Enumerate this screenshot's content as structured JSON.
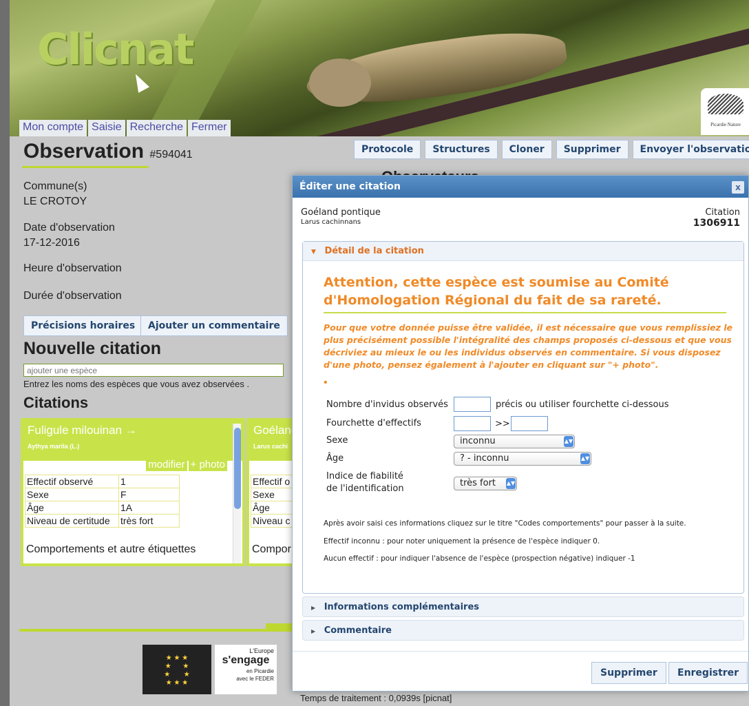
{
  "logo": "Clicnat",
  "partner_logo": "Picardie Nature",
  "nav": [
    "Mon compte",
    "Saisie",
    "Recherche",
    "Fermer"
  ],
  "toolbar": [
    "Protocole",
    "Structures",
    "Cloner",
    "Supprimer",
    "Envoyer l'observation"
  ],
  "observation": {
    "title": "Observation",
    "id": "#594041",
    "commune_label": "Commune(s)",
    "commune": "LE CROTOY",
    "date_label": "Date d'observation",
    "date": "17-12-2016",
    "heure_label": "Heure d'observation",
    "duree_label": "Durée d'observation",
    "btn_precisions": "Précisions horaires",
    "btn_commentaire": "Ajouter un commentaire",
    "observateurs": "Observateurs"
  },
  "new_citation": {
    "title": "Nouvelle citation",
    "placeholder": "ajouter une espèce",
    "help": "Entrez les noms des espèces que vous avez observées ."
  },
  "citations": {
    "title": "Citations",
    "cards": [
      {
        "name": "Fuligule milouinan →",
        "sci": "Aythya marila (L.)",
        "modify": "modifier",
        "photo": "+ photo",
        "rows": [
          [
            "Effectif observé",
            "1"
          ],
          [
            "Sexe",
            "F"
          ],
          [
            "Âge",
            "1A"
          ],
          [
            "Niveau de certitude",
            "très fort"
          ]
        ],
        "behaviours": "Comportements et autre étiquettes"
      },
      {
        "name": "Goéland",
        "sci": "Larus cachi",
        "rows": [
          [
            "Effectif o",
            ""
          ],
          [
            "Sexe",
            ""
          ],
          [
            "Âge",
            ""
          ],
          [
            "Niveau c",
            ""
          ]
        ],
        "behaviours": "Compor"
      }
    ]
  },
  "footer": {
    "europe_top": "L'Europe",
    "europe_mid": "s'engage",
    "europe_bot": "en Picardie",
    "europe_fund": "avec le FEDER",
    "timing": "Temps de traitement : 0,0939s [picnat]"
  },
  "dialog": {
    "title": "Éditer une citation",
    "close": "x",
    "species_common": "Goéland pontique",
    "species_sci": "Larus cachinnans",
    "citation_label": "Citation",
    "citation_id": "1306911",
    "section_detail": "Détail de la citation",
    "warning_title": "Attention, cette espèce est soumise au Comité d'Homologation Régional du fait de sa rareté.",
    "warning_body": "Pour que votre donnée puisse être validée, il est nécessaire que vous remplissiez le plus précisément possible l'intégralité des champs proposés ci-dessous et que vous décriviez au mieux le ou les individus observés en commentaire. Si vous disposez d'une photo, pensez également à l'ajouter en cliquant sur \"+ photo\".",
    "dot": "•",
    "field_nombre": "Nombre d'invidus observés",
    "field_nombre_hint": "précis ou utiliser fourchette ci-dessous",
    "field_fourchette": "Fourchette d'effectifs",
    "fourchette_sep": ">>",
    "field_sexe": "Sexe",
    "sexe_value": "inconnu",
    "field_age": "Âge",
    "age_value": "? - inconnu",
    "field_fiabilite_1": "Indice de fiabilité",
    "field_fiabilite_2": "de l'identification",
    "fiabilite_value": "très fort",
    "note1": "Après avoir saisi ces informations cliquez sur le titre \"Codes comportements\" pour passer à la suite.",
    "note2": "Effectif inconnu : pour noter uniquement la présence de l'espèce indiquer 0.",
    "note3": "Aucun effectif : pour indiquer l'absence de l'espèce (prospection négative) indiquer -1",
    "section_infos": "Informations complémentaires",
    "section_commentaire": "Commentaire",
    "btn_supprimer": "Supprimer",
    "btn_enregistrer": "Enregistrer"
  }
}
